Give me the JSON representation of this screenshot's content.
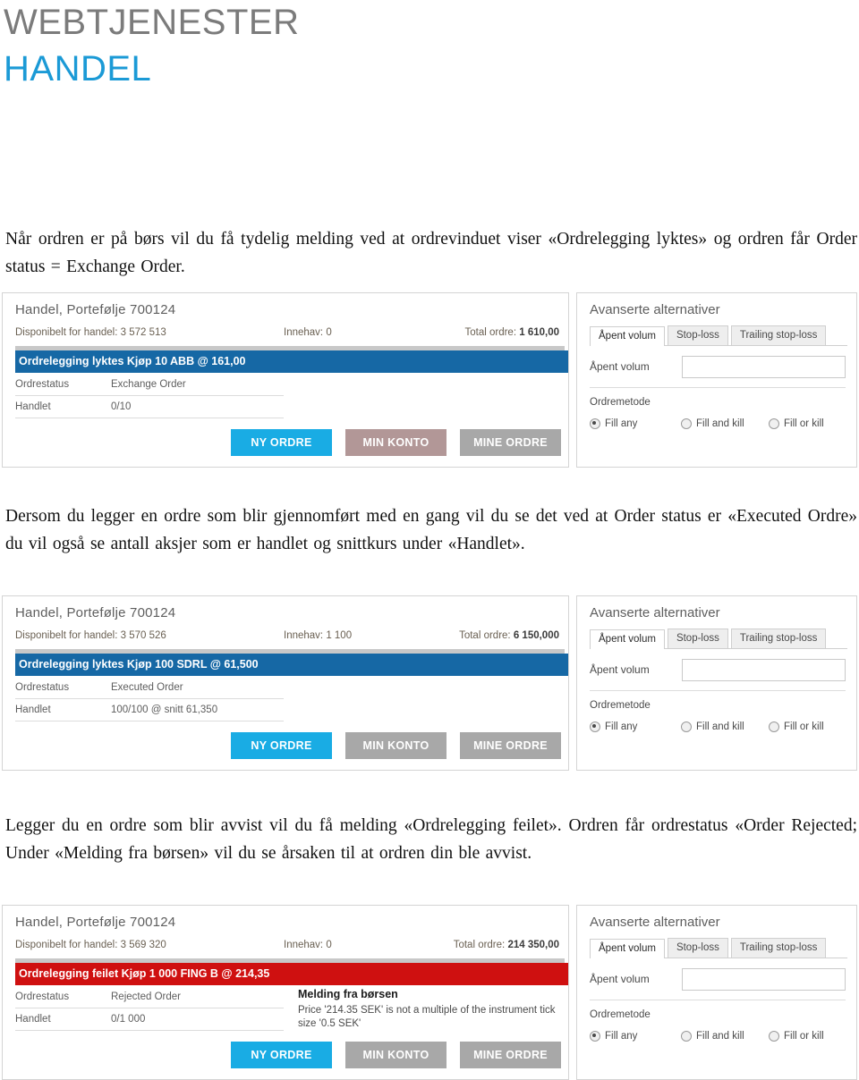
{
  "header": {
    "line1": "WEBTJENESTER",
    "line2": "HANDEL",
    "color_line1": "#7b7b7b",
    "color_line2": "#1b9ad6"
  },
  "paragraphs": {
    "p1": "Når ordren er på børs vil du få tydelig melding ved at ordrevinduet viser «Ordrelegging lyktes» og ordren får Order status = Exchange Order.",
    "p2": "Dersom du legger en ordre som blir gjennomført med en gang vil du se det ved at Order status er «Executed Ordre» du vil også se antall aksjer som er handlet og snittkurs under «Handlet».",
    "p3": "Legger du en ordre som blir avvist vil du få melding «Ordrelegging feilet». Ordren får ordrestatus «Order Rejected; Under «Melding fra børsen» vil du se årsaken til at ordren din ble avvist."
  },
  "advanced_panel": {
    "title": "Avanserte alternativer",
    "tabs": [
      {
        "label": "Åpent volum",
        "active": true
      },
      {
        "label": "Stop-loss",
        "active": false
      },
      {
        "label": "Trailing stop-loss",
        "active": false
      }
    ],
    "field_label": "Åpent volum",
    "field_value": "",
    "field_placeholder": "",
    "method_label": "Ordremetode",
    "radios": [
      {
        "label": "Fill any",
        "selected": true
      },
      {
        "label": "Fill and kill",
        "selected": false
      },
      {
        "label": "Fill or kill",
        "selected": false
      }
    ]
  },
  "buttons": {
    "new_order": "NY ORDRE",
    "my_account": "MIN KONTO",
    "my_orders": "MINE ORDRE"
  },
  "labels": {
    "available": "Disponibelt for handel:",
    "holding": "Innehav:",
    "total_order": "Total ordre:",
    "order_status": "Ordrestatus",
    "traded": "Handlet",
    "exchange_message_title": "Melding fra børsen"
  },
  "shots": [
    {
      "id": "shot-1",
      "title": "Handel, Portefølje 700124",
      "available": "Disponibelt for handel: 3 572 513",
      "holding": "Innehav: 0",
      "total_order_label": "Total ordre: ",
      "total_order_value": "1 610,00",
      "banner_text": "Ordrelegging lyktes Kjøp 10 ABB @ 161,00",
      "banner_state": "success",
      "banner_color": "#1668a5",
      "order_status_key": "Ordrestatus",
      "order_status_value": "Exchange Order",
      "traded_key": "Handlet",
      "traded_value": "0/10",
      "exchange_message_title": "",
      "exchange_message_body": "",
      "my_account_button_color": "#b29797"
    },
    {
      "id": "shot-2",
      "title": "Handel, Portefølje 700124",
      "available": "Disponibelt for handel: 3 570 526",
      "holding": "Innehav: 1 100",
      "total_order_label": "Total ordre: ",
      "total_order_value": "6 150,000",
      "banner_text": "Ordrelegging lyktes Kjøp 100 SDRL @ 61,500",
      "banner_state": "success",
      "banner_color": "#1668a5",
      "order_status_key": "Ordrestatus",
      "order_status_value": "Executed Order",
      "traded_key": "Handlet",
      "traded_value": "100/100 @ snitt 61,350",
      "exchange_message_title": "",
      "exchange_message_body": "",
      "my_account_button_color": "#a8a8a8"
    },
    {
      "id": "shot-3",
      "title": "Handel, Portefølje 700124",
      "available": "Disponibelt for handel: 3 569 320",
      "holding": "Innehav: 0",
      "total_order_label": "Total ordre: ",
      "total_order_value": "214 350,00",
      "banner_text": "Ordrelegging feilet Kjøp 1 000 FING B @ 214,35",
      "banner_state": "error",
      "banner_color": "#cf1010",
      "order_status_key": "Ordrestatus",
      "order_status_value": "Rejected Order",
      "traded_key": "Handlet",
      "traded_value": "0/1 000",
      "exchange_message_title": "Melding fra børsen",
      "exchange_message_body": "Price '214.35 SEK' is not a multiple of the instrument tick size '0.5 SEK'",
      "my_account_button_color": "#a8a8a8"
    }
  ]
}
